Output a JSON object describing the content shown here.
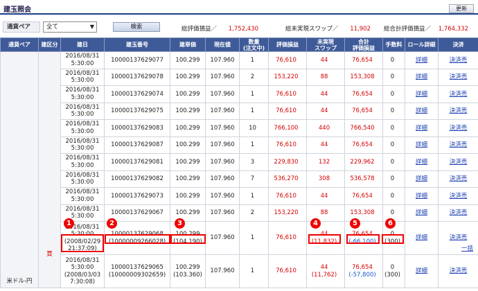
{
  "header": {
    "title": "建玉照会",
    "refresh_label": "更新"
  },
  "filter": {
    "pair_label": "通貨ペア",
    "pair_value": "全て",
    "search_label": "検索"
  },
  "summary": [
    {
      "label": "総評価損益／",
      "value": "1,752,430"
    },
    {
      "label": "総未実現スワップ／",
      "value": "11,902"
    },
    {
      "label": "総合計評価損益／",
      "value": "1,764,332"
    }
  ],
  "columns": [
    "通貨ペア",
    "建区分",
    "建日",
    "建玉番号",
    "建単価",
    "現在値",
    "数量\n(注文中)",
    "評価損益",
    "未実現\nスワップ",
    "合計\n評価損益",
    "手数料",
    "ロール詳細",
    "決済"
  ],
  "pair": "米ドル-円",
  "side": "買",
  "bulk_label": "一括",
  "link_detail": "詳細",
  "link_settle": "決済売",
  "rows": [
    {
      "date1": "2016/08/31",
      "date2": "5:30:00",
      "date3": "",
      "no": "10000137629077",
      "no2": "",
      "price": "100.299",
      "price2": "",
      "cur": "107.960",
      "qty": "1",
      "pl": "76,610",
      "swap": "44",
      "swap2": "",
      "total": "76,654",
      "total2": "",
      "fee": "0",
      "fee2": ""
    },
    {
      "date1": "2016/08/31",
      "date2": "5:30:00",
      "date3": "",
      "no": "10000137629078",
      "no2": "",
      "price": "100.299",
      "price2": "",
      "cur": "107.960",
      "qty": "2",
      "pl": "153,220",
      "swap": "88",
      "swap2": "",
      "total": "153,308",
      "total2": "",
      "fee": "0",
      "fee2": ""
    },
    {
      "date1": "2016/08/31",
      "date2": "5:30:00",
      "date3": "",
      "no": "10000137629074",
      "no2": "",
      "price": "100.299",
      "price2": "",
      "cur": "107.960",
      "qty": "1",
      "pl": "76,610",
      "swap": "44",
      "swap2": "",
      "total": "76,654",
      "total2": "",
      "fee": "0",
      "fee2": ""
    },
    {
      "date1": "2016/08/31",
      "date2": "5:30:00",
      "date3": "",
      "no": "10000137629075",
      "no2": "",
      "price": "100.299",
      "price2": "",
      "cur": "107.960",
      "qty": "1",
      "pl": "76,610",
      "swap": "44",
      "swap2": "",
      "total": "76,654",
      "total2": "",
      "fee": "0",
      "fee2": ""
    },
    {
      "date1": "2016/08/31",
      "date2": "5:30:00",
      "date3": "",
      "no": "10000137629083",
      "no2": "",
      "price": "100.299",
      "price2": "",
      "cur": "107.960",
      "qty": "10",
      "pl": "766,100",
      "swap": "440",
      "swap2": "",
      "total": "766,540",
      "total2": "",
      "fee": "0",
      "fee2": ""
    },
    {
      "date1": "2016/08/31",
      "date2": "5:30:00",
      "date3": "",
      "no": "10000137629087",
      "no2": "",
      "price": "100.299",
      "price2": "",
      "cur": "107.960",
      "qty": "1",
      "pl": "76,610",
      "swap": "44",
      "swap2": "",
      "total": "76,654",
      "total2": "",
      "fee": "0",
      "fee2": ""
    },
    {
      "date1": "2016/08/31",
      "date2": "5:30:00",
      "date3": "",
      "no": "10000137629081",
      "no2": "",
      "price": "100.299",
      "price2": "",
      "cur": "107.960",
      "qty": "3",
      "pl": "229,830",
      "swap": "132",
      "swap2": "",
      "total": "229,962",
      "total2": "",
      "fee": "0",
      "fee2": ""
    },
    {
      "date1": "2016/08/31",
      "date2": "5:30:00",
      "date3": "",
      "no": "10000137629082",
      "no2": "",
      "price": "100.299",
      "price2": "",
      "cur": "107.960",
      "qty": "7",
      "pl": "536,270",
      "swap": "308",
      "swap2": "",
      "total": "536,578",
      "total2": "",
      "fee": "0",
      "fee2": ""
    },
    {
      "date1": "2016/08/31",
      "date2": "5:30:00",
      "date3": "",
      "no": "10000137629073",
      "no2": "",
      "price": "100.299",
      "price2": "",
      "cur": "107.960",
      "qty": "1",
      "pl": "76,610",
      "swap": "44",
      "swap2": "",
      "total": "76,654",
      "total2": "",
      "fee": "0",
      "fee2": ""
    },
    {
      "date1": "2016/08/31",
      "date2": "5:30:00",
      "date3": "",
      "no": "10000137629067",
      "no2": "",
      "price": "100.299",
      "price2": "",
      "cur": "107.960",
      "qty": "2",
      "pl": "153,220",
      "swap": "88",
      "swap2": "",
      "total": "153,308",
      "total2": "",
      "fee": "0",
      "fee2": ""
    },
    {
      "date1": "2016/08/31",
      "date2": "5:30:00",
      "date3": "(2008/02/29 21:37:09)",
      "no": "10000137629068",
      "no2": "(10000009266028)",
      "price": "100.299",
      "price2": "(104.190)",
      "cur": "107.960",
      "qty": "1",
      "pl": "76,610",
      "swap": "44",
      "swap2": "(11,832)",
      "total": "76,654",
      "total2": "(-66,100)",
      "fee": "0",
      "fee2": "(300)"
    },
    {
      "date1": "2016/08/31",
      "date2": "5:30:00",
      "date3": "(2008/03/03 7:30:08)",
      "no": "10000137629065",
      "no2": "(10000009302659)",
      "price": "100.299",
      "price2": "(103.360)",
      "cur": "107.960",
      "qty": "1",
      "pl": "76,610",
      "swap": "44",
      "swap2": "(11,762)",
      "total": "76,654",
      "total2": "(-57,800)",
      "fee": "0",
      "fee2": "(300)"
    }
  ],
  "markers": [
    "1",
    "2",
    "3",
    "4",
    "5",
    "6"
  ],
  "colors": {
    "header_bg": "#3e5a98",
    "positive": "#d40000",
    "negative": "#1a56c8",
    "marker": "#e00000"
  }
}
